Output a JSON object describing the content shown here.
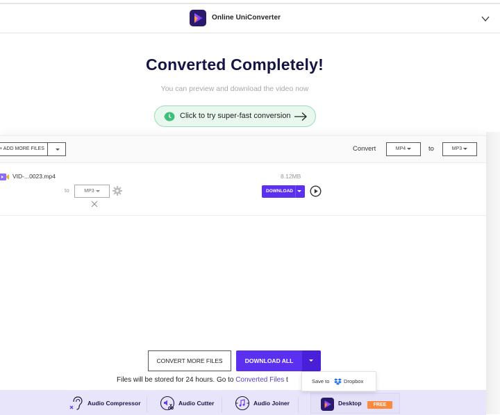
{
  "header": {
    "brand": "Online UniConverter",
    "logo_icon": "uniconverter-logo",
    "menu_icon": "chevron-down-icon"
  },
  "hero": {
    "title": "Converted Completely!",
    "subtitle": "You can preview and download the video now",
    "fast_button_label": "Click to try super-fast conversion",
    "fast_button_icon": "clock-icon",
    "fast_button_arrow": "arrow-right-icon"
  },
  "toolbar": {
    "add_more_label": "+ ADD MORE FILES",
    "convert_label": "Convert",
    "from_format": "MP4",
    "to_label": "to",
    "to_format": "MP3"
  },
  "files": [
    {
      "name": "VID-...0023.mp4",
      "size": "8.12MB",
      "to_label": "to",
      "target_format": "MP3",
      "download_label": "DOWNLOAD"
    }
  ],
  "actions": {
    "convert_more_label": "CONVERT MORE FILES",
    "download_all_label": "DOWNLOAD ALL",
    "store_text": "Files will be stored for 24 hours. Go to ",
    "store_link": "Converted Files",
    "store_tail": " t",
    "dropdown": {
      "save_to": "Save to",
      "service": "Dropbox"
    }
  },
  "footer": {
    "tools": [
      {
        "label": "Audio Compressor",
        "icon": "ear-icon"
      },
      {
        "label": "Audio Cutter",
        "icon": "audio-cutter-icon"
      },
      {
        "label": "Audio Joiner",
        "icon": "music-note-icon"
      }
    ],
    "desktop_label": "Desktop",
    "desktop_badge": "FREE"
  },
  "colors": {
    "accent": "#5b30f0",
    "title": "#151346",
    "badge": "#fd8a3c",
    "footer_bg": "#e8e5fb",
    "fast_bg": "#e9f8ef"
  }
}
